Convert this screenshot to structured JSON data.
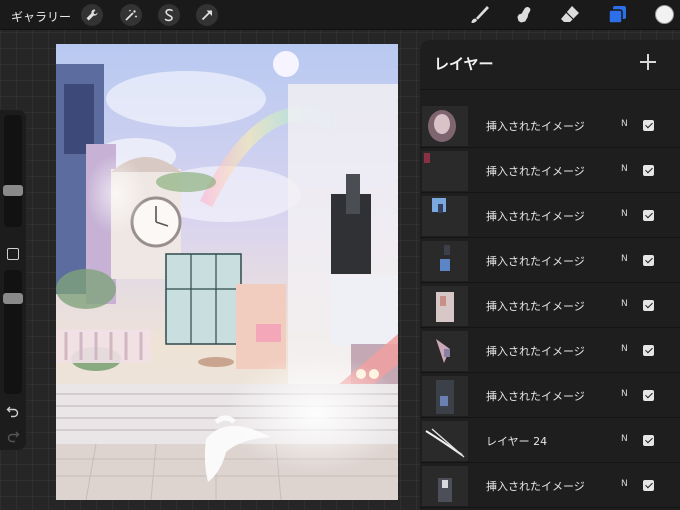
{
  "topbar": {
    "gallery_label": "ギャラリー",
    "left_tools": [
      "wrench-icon",
      "magic-wand-icon",
      "selection-s-icon",
      "transform-arrow-icon"
    ],
    "right_tools": [
      "brush-icon",
      "smudge-icon",
      "eraser-icon",
      "layers-icon"
    ],
    "accent_color": "#2d6fe8",
    "current_color": "#f2f2f2"
  },
  "sidebar": {
    "brush_size": 0.25,
    "opacity": 0.55,
    "tools": [
      "modify-square-icon",
      "undo-icon",
      "redo-icon"
    ]
  },
  "layers_panel": {
    "title": "レイヤー",
    "add_icon": "plus-icon",
    "layers": [
      {
        "name": "挿入されたイメージ",
        "blend": "N",
        "visible": true
      },
      {
        "name": "挿入されたイメージ",
        "blend": "N",
        "visible": true
      },
      {
        "name": "挿入されたイメージ",
        "blend": "N",
        "visible": true
      },
      {
        "name": "挿入されたイメージ",
        "blend": "N",
        "visible": true
      },
      {
        "name": "挿入されたイメージ",
        "blend": "N",
        "visible": true
      },
      {
        "name": "挿入されたイメージ",
        "blend": "N",
        "visible": true
      },
      {
        "name": "挿入されたイメージ",
        "blend": "N",
        "visible": true
      },
      {
        "name": "レイヤー 24",
        "blend": "N",
        "visible": true
      },
      {
        "name": "挿入されたイメージ",
        "blend": "N",
        "visible": true
      }
    ]
  }
}
